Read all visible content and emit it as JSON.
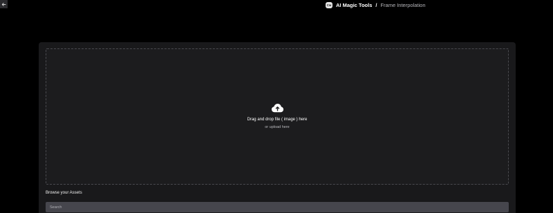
{
  "nav": {
    "back_icon": "arrow-left-icon"
  },
  "header": {
    "badge_text": "Cw",
    "app_title": "AI Magic Tools",
    "separator": "/",
    "current_page": "Frame Interpolation"
  },
  "dropzone": {
    "icon": "cloud-upload-icon",
    "title": "Drag and drop file ( image ) here",
    "subtitle": "or upload here"
  },
  "assets": {
    "heading": "Browse your Assets",
    "search_placeholder": "Search"
  },
  "colors": {
    "background": "#000000",
    "panel": "#19191b",
    "dropzone_border": "#4a4a4f",
    "search_bg": "#46464d"
  }
}
